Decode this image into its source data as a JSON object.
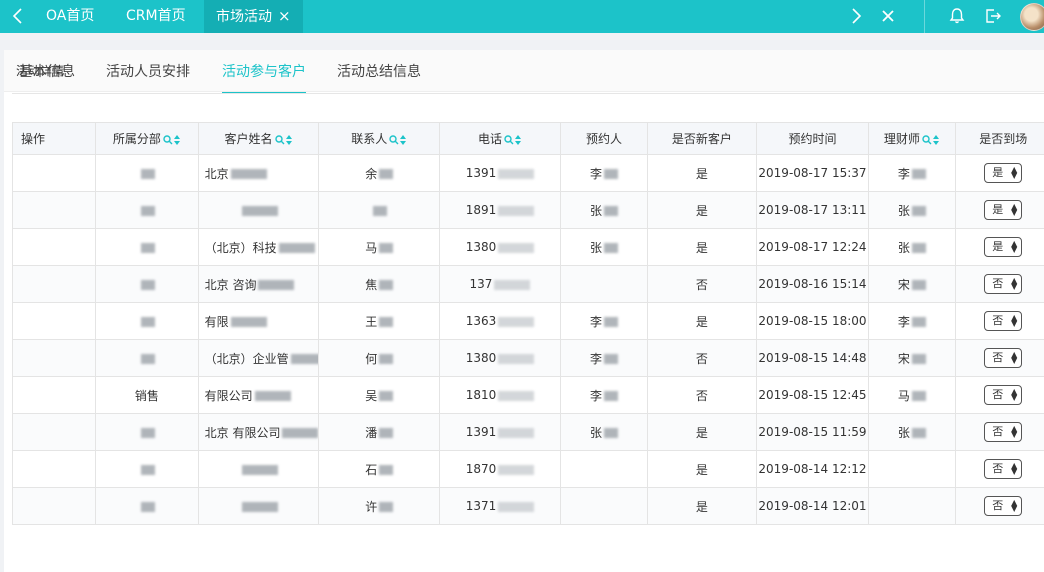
{
  "topbar": {
    "tabs": [
      {
        "label": "OA首页"
      },
      {
        "label": "CRM首页"
      },
      {
        "label": "市场活动",
        "close": "×"
      }
    ]
  },
  "card": {
    "title": "活动详情",
    "subtabs": [
      {
        "label": "基本信息"
      },
      {
        "label": "活动人员安排"
      },
      {
        "label": "活动参与客户"
      },
      {
        "label": "活动总结信息"
      }
    ]
  },
  "table": {
    "columns": [
      "操作",
      "所属分部",
      "客户姓名",
      "联系人",
      "电话",
      "预约人",
      "是否新客户",
      "预约时间",
      "理财师",
      "是否到场"
    ],
    "rows": [
      {
        "branch": "",
        "customer": "北京",
        "contact": "余",
        "phone": "1391",
        "booker": "李",
        "is_new": "是",
        "time": "2019-08-17 15:37",
        "advisor": "李",
        "arrived": "是"
      },
      {
        "branch": "",
        "customer": "",
        "contact": "",
        "phone": "1891",
        "booker": "张",
        "is_new": "是",
        "time": "2019-08-17 13:11",
        "advisor": "张",
        "arrived": "是"
      },
      {
        "branch": "",
        "customer": "（北京）科技",
        "contact": "马",
        "phone": "1380",
        "booker": "张",
        "is_new": "是",
        "time": "2019-08-17 12:24",
        "advisor": "张",
        "arrived": "是"
      },
      {
        "branch": "",
        "customer": "北京 咨询",
        "contact": "焦",
        "phone": "137",
        "booker": "",
        "is_new": "否",
        "time": "2019-08-16 15:14",
        "advisor": "宋",
        "arrived": "否"
      },
      {
        "branch": "",
        "customer": "有限",
        "contact": "王",
        "phone": "1363",
        "booker": "李",
        "is_new": "是",
        "time": "2019-08-15 18:00",
        "advisor": "李",
        "arrived": "否"
      },
      {
        "branch": "",
        "customer": "（北京）企业管",
        "contact": "何",
        "phone": "1380",
        "booker": "李",
        "is_new": "否",
        "time": "2019-08-15 14:48",
        "advisor": "宋",
        "arrived": "否"
      },
      {
        "branch": "销售",
        "customer": "有限公司",
        "contact": "吴",
        "phone": "1810",
        "booker": "李",
        "is_new": "否",
        "time": "2019-08-15 12:45",
        "advisor": "马",
        "arrived": "否"
      },
      {
        "branch": "",
        "customer": "北京 有限公司",
        "contact": "潘",
        "phone": "1391",
        "booker": "张",
        "is_new": "是",
        "time": "2019-08-15 11:59",
        "advisor": "张",
        "arrived": "否"
      },
      {
        "branch": "",
        "customer": "",
        "contact": "石",
        "phone": "1870",
        "booker": "",
        "is_new": "是",
        "time": "2019-08-14 12:12",
        "advisor": "",
        "arrived": "否"
      },
      {
        "branch": "",
        "customer": "",
        "contact": "许",
        "phone": "1371",
        "booker": "",
        "is_new": "是",
        "time": "2019-08-14 12:01",
        "advisor": "",
        "arrived": "否"
      }
    ]
  },
  "colors": {
    "accent": "#1cc3c9",
    "active_tab": "#14aeb4"
  },
  "icons": [
    "chevron-left-icon",
    "chevron-right-icon",
    "close-all-icon",
    "bell-icon",
    "logout-icon",
    "search-icon",
    "sort-icon",
    "select-arrow-icon"
  ]
}
